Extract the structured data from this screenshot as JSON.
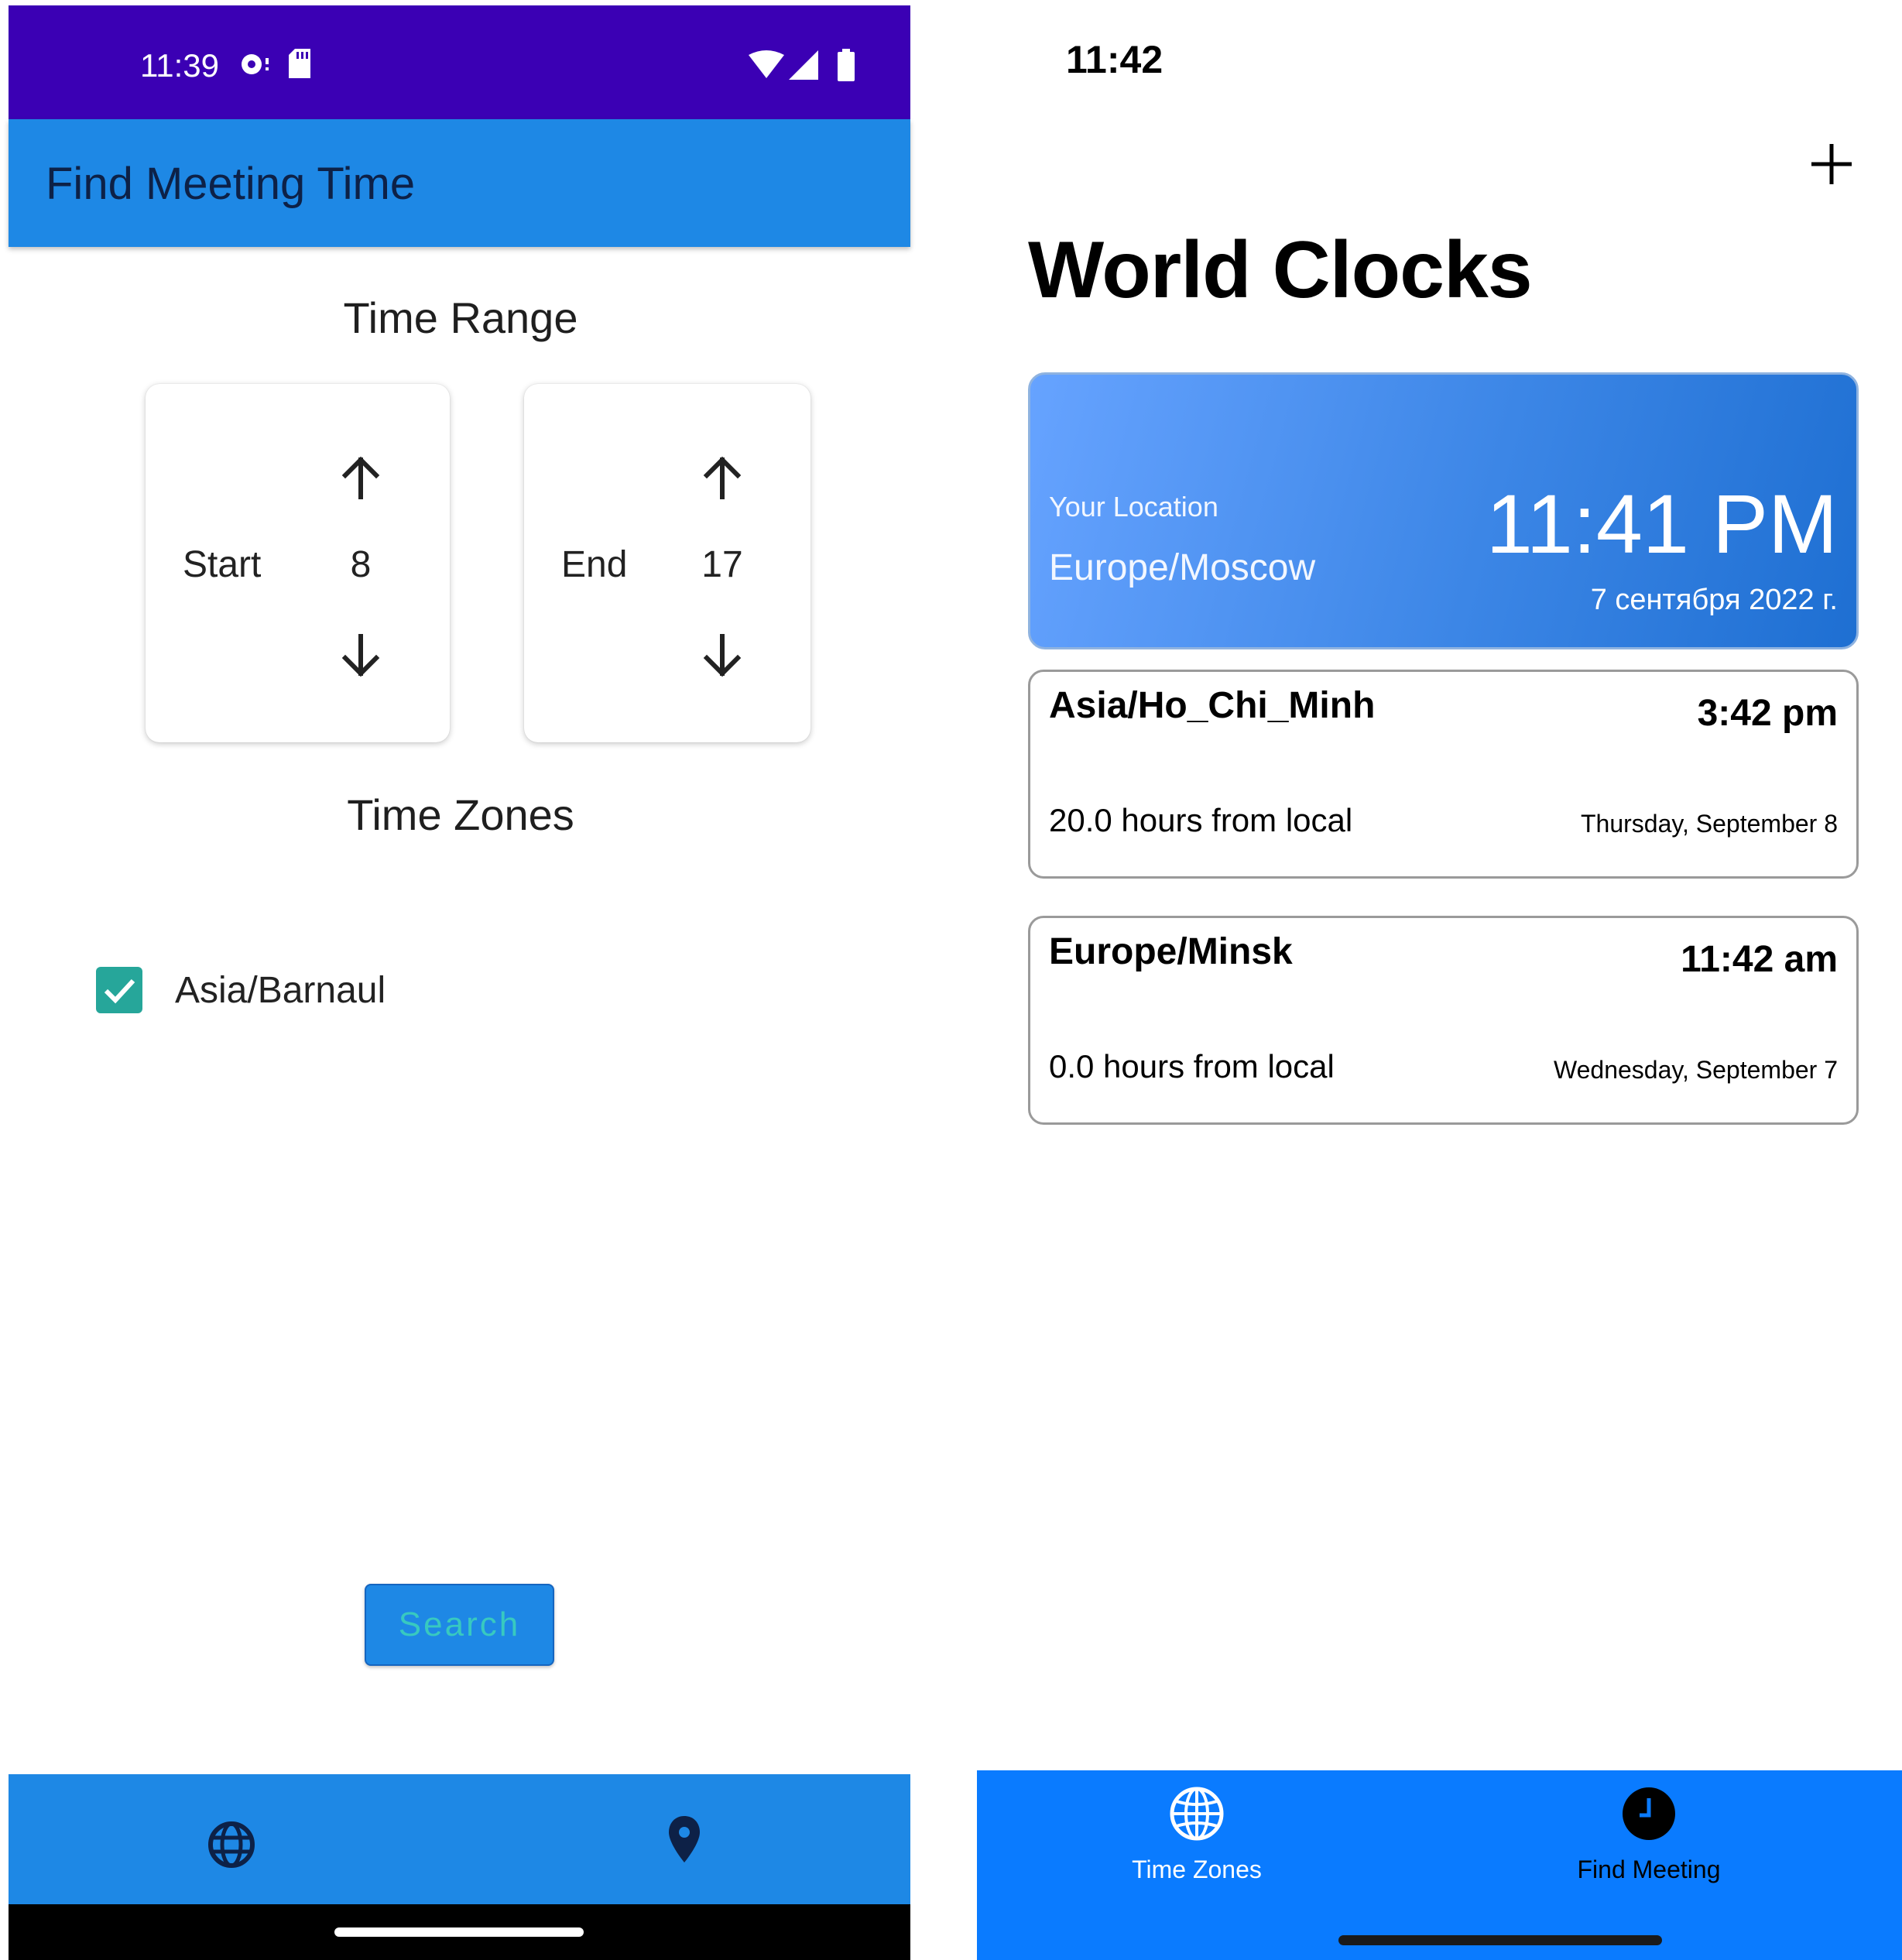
{
  "android": {
    "status_bar": {
      "time": "11:39"
    },
    "app_bar": {
      "title": "Find Meeting Time"
    },
    "time_range": {
      "title": "Time Range",
      "start": {
        "label": "Start",
        "value": "8"
      },
      "end": {
        "label": "End",
        "value": "17"
      }
    },
    "time_zones": {
      "title": "Time Zones",
      "items": [
        {
          "label": "Asia/Barnaul",
          "checked": true
        }
      ]
    },
    "search_label": "Search",
    "bottom_nav": {
      "items": [
        {
          "icon": "globe-icon"
        },
        {
          "icon": "location-pin-icon"
        }
      ]
    },
    "colors": {
      "status_bar": "#3b00b4",
      "app_bar": "#1e88e5",
      "checkbox": "#26a69a",
      "search_text": "#38c9c0"
    }
  },
  "ios": {
    "status_bar": {
      "time": "11:42"
    },
    "title": "World Clocks",
    "add_icon": "plus-icon",
    "hero": {
      "location_label": "Your Location",
      "location_name": "Europe/Moscow",
      "time": "11:41 PM",
      "date": "7 сентября 2022 г."
    },
    "zones": [
      {
        "name": "Asia/Ho_Chi_Minh",
        "time": "3:42 pm",
        "offset": "20.0 hours from local",
        "date": "Thursday, September 8"
      },
      {
        "name": "Europe/Minsk",
        "time": "11:42 am",
        "offset": "0.0 hours from local",
        "date": "Wednesday, September 7"
      }
    ],
    "tabs": [
      {
        "label": "Time Zones",
        "icon": "globe-icon",
        "color": "#ffffff"
      },
      {
        "label": "Find Meeting",
        "icon": "clock-icon",
        "color": "#000000"
      }
    ],
    "colors": {
      "tab_bar": "#0a7bff"
    }
  }
}
